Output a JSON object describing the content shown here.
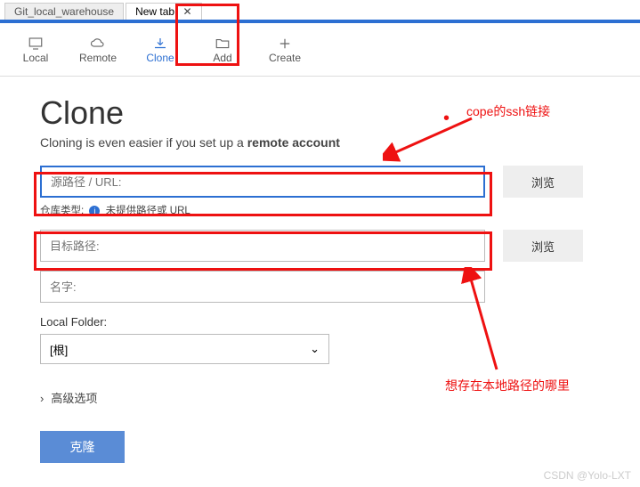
{
  "tabs": {
    "first": "Git_local_warehouse",
    "second": "New tab",
    "close": "✕"
  },
  "toolbar": {
    "local": "Local",
    "remote": "Remote",
    "clone": "Clone",
    "add": "Add",
    "create": "Create"
  },
  "page": {
    "title": "Clone",
    "subtitle_a": "Cloning is even easier if you set up a ",
    "subtitle_b": "remote account"
  },
  "fields": {
    "source_placeholder": "源路径 / URL:",
    "repo_type_label": "仓库类型:",
    "repo_type_msg": "未提供路径或 URL",
    "dest_placeholder": "目标路径:",
    "name_placeholder": "名字:",
    "browse": "浏览",
    "local_folder_label": "Local Folder:",
    "local_folder_value": "[根]"
  },
  "advanced": "高级选项",
  "clone_btn": "克隆",
  "annotations": {
    "a1": "cope的ssh链接",
    "a2": "想存在本地路径的哪里"
  },
  "watermark": "CSDN @Yolo-LXT"
}
